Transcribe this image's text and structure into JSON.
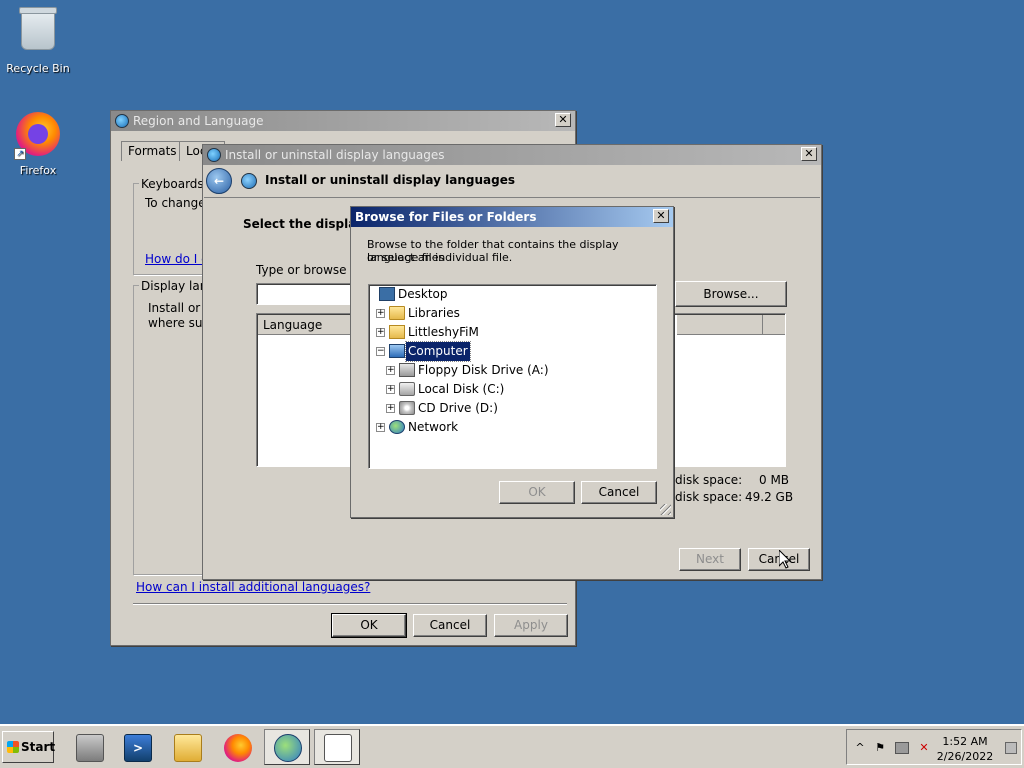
{
  "desktop": {
    "icons": [
      {
        "label": "Recycle Bin",
        "icon": "recycle-bin-icon"
      },
      {
        "label": "Firefox",
        "icon": "firefox-icon"
      }
    ]
  },
  "region_window": {
    "title": "Region and Language",
    "tabs": [
      "Formats",
      "Locat"
    ],
    "keyboards_group_label": "Keyboards a",
    "keyboards_text": "To change",
    "keyboards_link": "How do I c",
    "display_group_label": "Display lang",
    "display_text_1": "Install or u",
    "display_text_2": "where sup",
    "install_link": "How can I install additional languages?",
    "ok_label": "OK",
    "cancel_label": "Cancel",
    "apply_label": "Apply"
  },
  "install_window": {
    "title": "Install or uninstall display languages",
    "header": "Install or uninstall display languages",
    "select_text": "Select the display l",
    "type_browse_text": "Type or browse to",
    "path_value": "",
    "browse_label": "Browse...",
    "column_language": "Language",
    "disk_space_required_label": "disk space:",
    "disk_space_required_value": "0 MB",
    "disk_space_available_label": "disk space:",
    "disk_space_available_value": "49.2 GB",
    "next_label": "Next",
    "cancel_label": "Cancel"
  },
  "browse_dialog": {
    "title": "Browse for Files or Folders",
    "instructions_1": "Browse to the folder that contains the display language files",
    "instructions_2": "or select an individual file.",
    "tree": [
      {
        "label": "Desktop",
        "icon": "desktop-icon",
        "expander": ""
      },
      {
        "label": "Libraries",
        "icon": "libraries-icon",
        "expander": "+"
      },
      {
        "label": "LittleshyFiM",
        "icon": "user-folder-icon",
        "expander": "+"
      },
      {
        "label": "Computer",
        "icon": "computer-icon",
        "expander": "−",
        "selected": true
      },
      {
        "label": "Floppy Disk Drive (A:)",
        "icon": "floppy-drive-icon",
        "expander": "+"
      },
      {
        "label": "Local Disk (C:)",
        "icon": "local-disk-icon",
        "expander": "+"
      },
      {
        "label": "CD Drive (D:)",
        "icon": "cd-drive-icon",
        "expander": "+"
      },
      {
        "label": "Network",
        "icon": "network-icon",
        "expander": "+"
      }
    ],
    "ok_label": "OK",
    "cancel_label": "Cancel"
  },
  "taskbar": {
    "start_label": "Start",
    "time": "1:52 AM",
    "date": "2/26/2022",
    "apps": [
      "server-manager-icon",
      "powershell-icon",
      "file-explorer-icon",
      "firefox-icon",
      "region-language-icon",
      "install-languages-icon"
    ],
    "tray_expand": "^",
    "tray_icons": [
      "action-center-flag-icon",
      "network-status-icon",
      "volume-muted-icon"
    ]
  }
}
